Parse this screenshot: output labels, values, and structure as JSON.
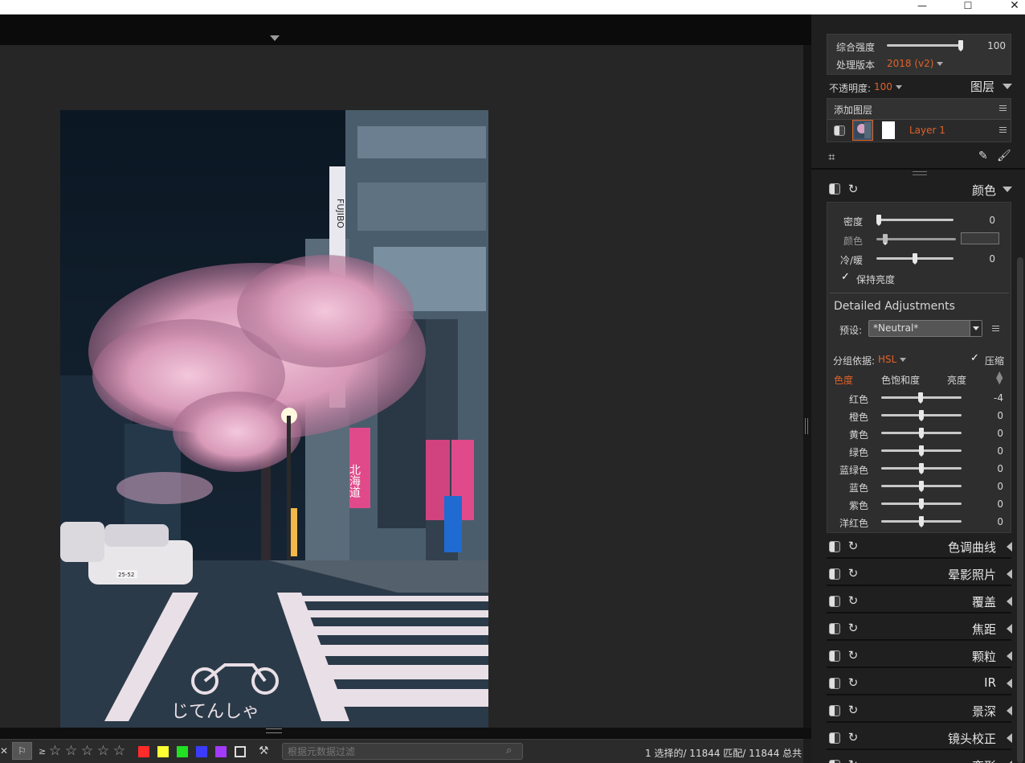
{
  "window": {
    "minimize": "—",
    "maximize": "☐",
    "close": "✕"
  },
  "bottombar": {
    "close_glyph": "✕",
    "flag_glyph": "⚐",
    "min_rating": "≥",
    "stars": [
      "☆",
      "☆",
      "☆",
      "☆",
      "☆"
    ],
    "color_labels": [
      "#ff2a2a",
      "#ffff33",
      "#22e022",
      "#3b3bff",
      "#a23bff"
    ],
    "search_placeholder": "根据元数据过滤",
    "status": "1 选择的/ 11844 匹配/ 11844 总共"
  },
  "global": {
    "strength_label": "综合强度",
    "strength_value": "100",
    "strength_level": 1.0,
    "process_label": "处理版本",
    "process_value": "2018 (v2)"
  },
  "layers": {
    "opacity_label": "不透明度:",
    "opacity_value": "100",
    "title": "图层",
    "add_layer": "添加图层",
    "layer_name": "Layer 1"
  },
  "color_panel": {
    "title": "颜色",
    "density_label": "密度",
    "density_value": "0",
    "color_label": "颜色",
    "warmth_label": "冷/暖",
    "warmth_value": "0",
    "preserve_luma": "保持亮度",
    "detailed_title": "Detailed Adjustments",
    "preset_label": "预设:",
    "preset_value": "*Neutral*",
    "group_label": "分组依据:",
    "group_value": "HSL",
    "compress_label": "压缩",
    "col_hue": "色度",
    "col_sat": "色饱和度",
    "col_lum": "亮度",
    "hsl_rows": [
      {
        "label": "红色",
        "value": "-4"
      },
      {
        "label": "橙色",
        "value": "0"
      },
      {
        "label": "黄色",
        "value": "0"
      },
      {
        "label": "绿色",
        "value": "0"
      },
      {
        "label": "蓝绿色",
        "value": "0"
      },
      {
        "label": "蓝色",
        "value": "0"
      },
      {
        "label": "紫色",
        "value": "0"
      },
      {
        "label": "洋红色",
        "value": "0"
      }
    ]
  },
  "collapsed_panels": [
    {
      "title": "色调曲线"
    },
    {
      "title": "晕影照片"
    },
    {
      "title": "覆盖"
    },
    {
      "title": "焦距"
    },
    {
      "title": "颗粒"
    },
    {
      "title": "IR"
    },
    {
      "title": "景深"
    },
    {
      "title": "镜头校正"
    },
    {
      "title": "变形"
    }
  ],
  "photo": {
    "sign_fujibo": "FUJIBO",
    "sign_hokkaido": "北海道",
    "road_text": "じてんしゃ",
    "plate": "25-52"
  }
}
